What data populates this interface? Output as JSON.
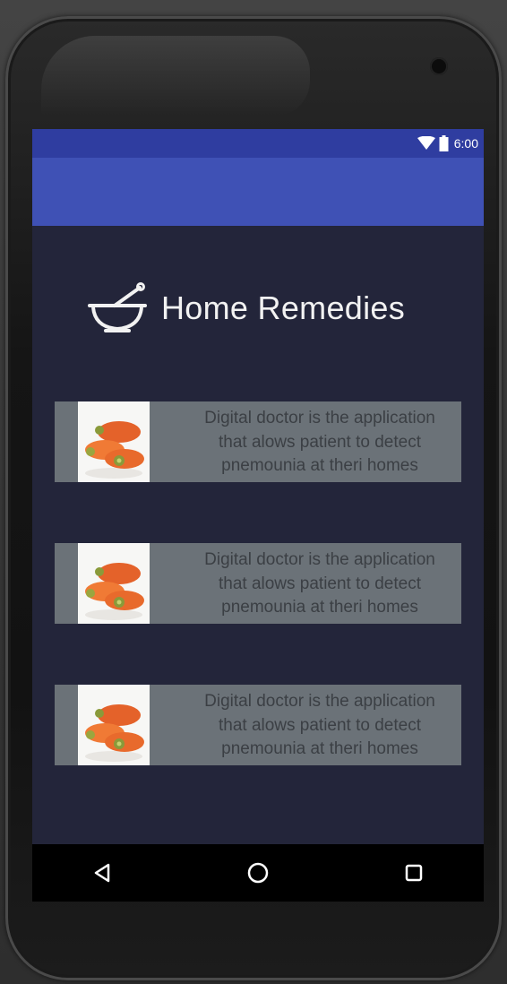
{
  "status_bar": {
    "time": "6:00",
    "icons": [
      "wifi-icon",
      "battery-icon"
    ],
    "color": "#2f3da0"
  },
  "app_bar": {
    "color": "#3f51b5"
  },
  "header": {
    "icon": "mortar-bowl-icon",
    "title": "Home Remedies"
  },
  "cards": [
    {
      "image": "carrots-image",
      "text_lines": [
        "Digital doctor is the application",
        "that alows patient to detect",
        "pnemounia at theri homes"
      ]
    },
    {
      "image": "carrots-image",
      "text_lines": [
        "Digital doctor is the application",
        "that alows patient to detect",
        "pnemounia at theri homes"
      ]
    },
    {
      "image": "carrots-image",
      "text_lines": [
        "Digital doctor is the application",
        "that alows patient to detect",
        "pnemounia at theri homes"
      ]
    }
  ],
  "nav_bar": {
    "buttons": [
      "back-icon",
      "home-icon",
      "recents-icon"
    ]
  },
  "colors": {
    "screen_background": "#23253a",
    "card_background": "#6b7278",
    "card_text": "#3b3f44",
    "title_text": "#f2f2f2"
  }
}
